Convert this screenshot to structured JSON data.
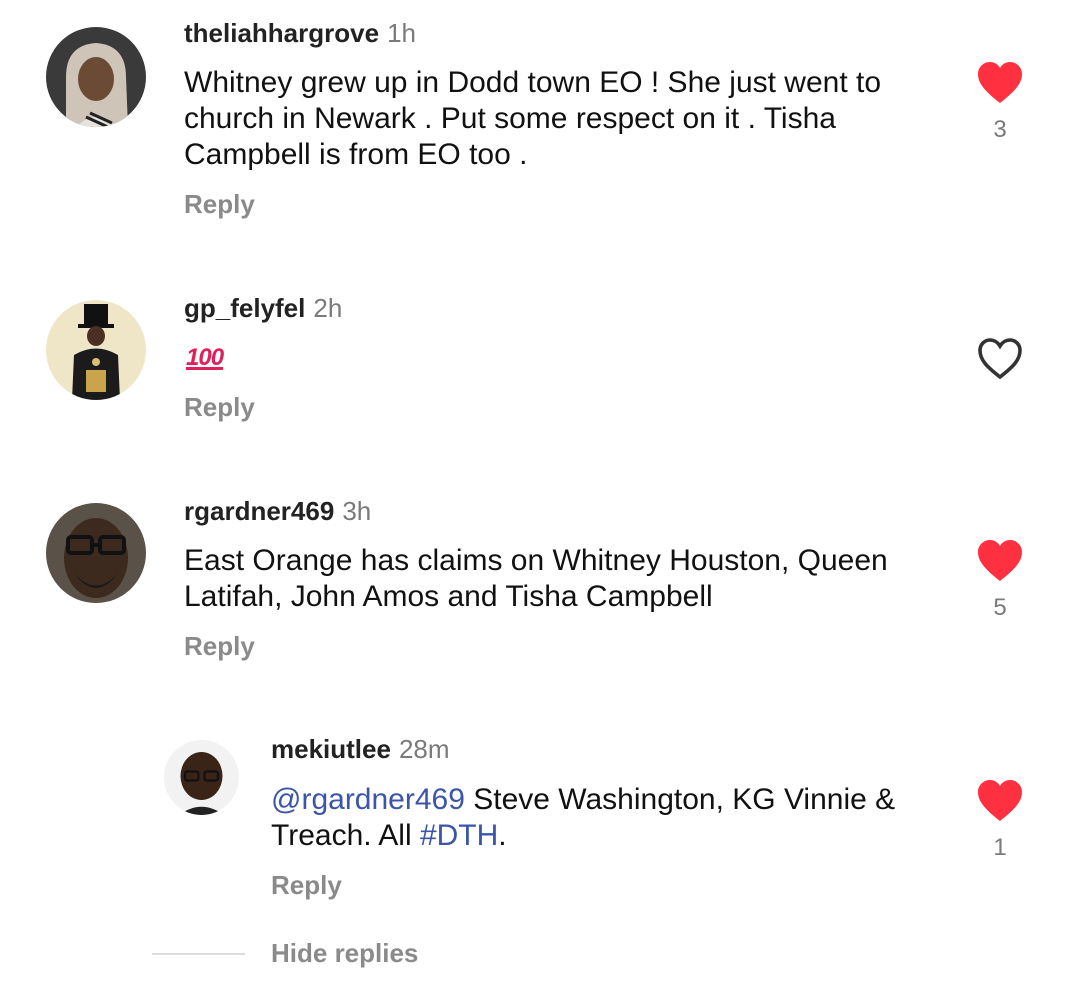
{
  "comments": [
    {
      "username": "theliahhargrove",
      "time": "1h",
      "text": "Whitney grew up in Dodd town EO ! She just went to church in Newark . Put some respect on it . Tisha Campbell is from EO too .",
      "reply_label": "Reply",
      "liked": true,
      "like_count": "3"
    },
    {
      "username": "gp_felyfel",
      "time": "2h",
      "emoji": "100",
      "reply_label": "Reply",
      "liked": false,
      "like_count": ""
    },
    {
      "username": "rgardner469",
      "time": "3h",
      "text": "East Orange has claims on Whitney Houston, Queen Latifah,  John Amos and Tisha Campbell",
      "reply_label": "Reply",
      "liked": true,
      "like_count": "5"
    }
  ],
  "reply": {
    "username": "mekiutlee",
    "time": "28m",
    "mention": "@rgardner469",
    "text_before_hashtag": " Steve Washington, KG Vinnie & Treach. All ",
    "hashtag": "#DTH",
    "text_after_hashtag": ".",
    "reply_label": "Reply",
    "liked": true,
    "like_count": "1"
  },
  "hide_replies_label": "Hide replies",
  "colors": {
    "like_red": "#ff3040",
    "link_blue": "#3b55a8",
    "muted_gray": "#8a8a8a"
  },
  "icons": {
    "liked": "heart-filled-icon",
    "unliked": "heart-outline-icon"
  }
}
